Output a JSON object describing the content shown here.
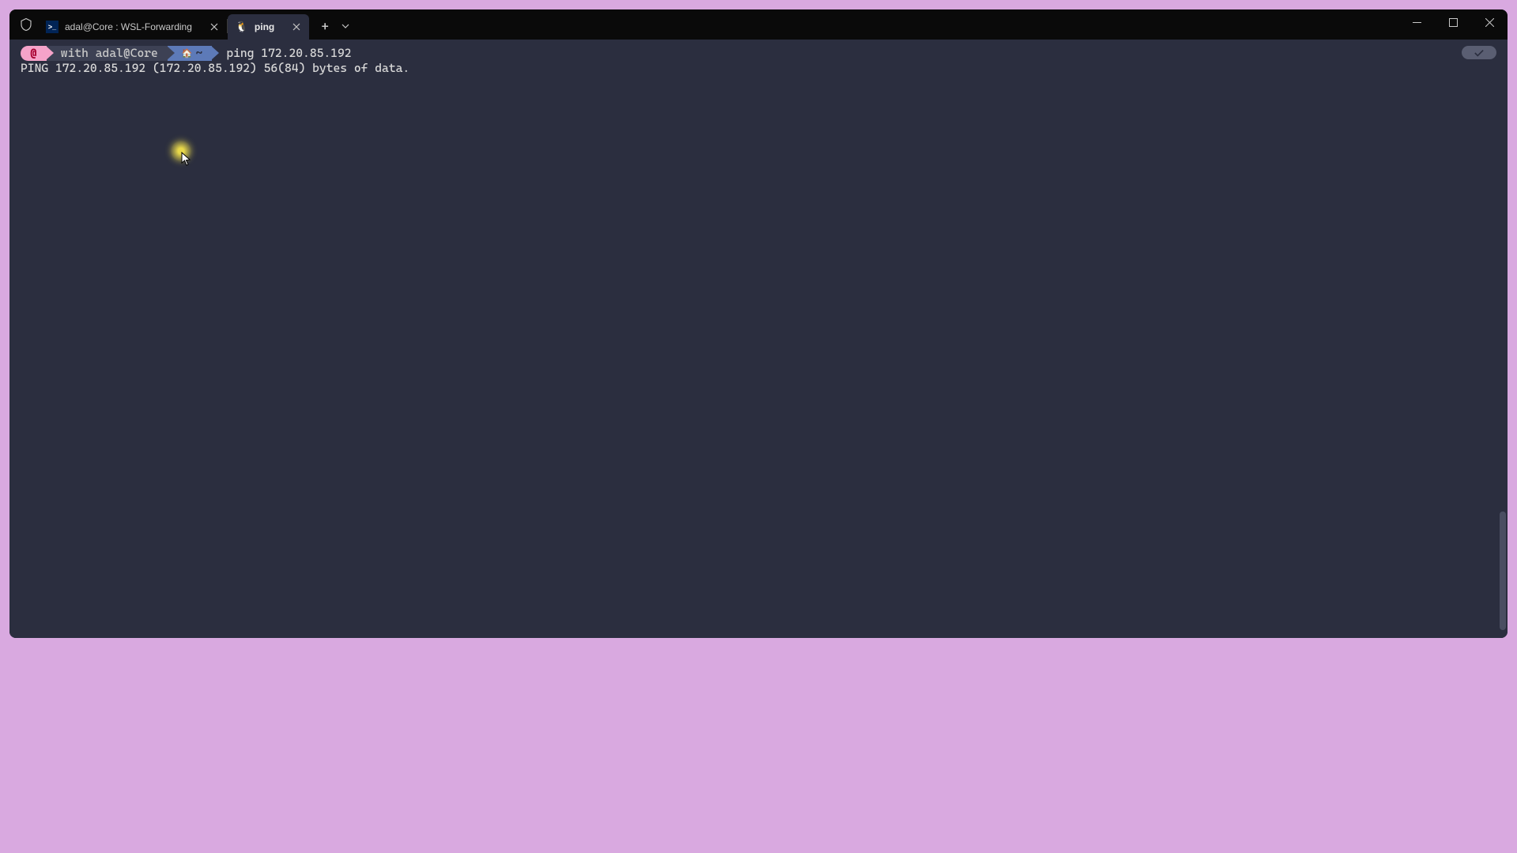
{
  "tabs": [
    {
      "label": "adal@Core : WSL-Forwarding",
      "icon": "powershell"
    },
    {
      "label": "ping",
      "icon": "tux"
    }
  ],
  "prompt": {
    "seg1_icon": "debian",
    "seg2_text": "with adal@Core",
    "seg3_home": "~",
    "command": "ping 172.20.85.192"
  },
  "output": {
    "line1": "PING 172.20.85.192 (172.20.85.192) 56(84) bytes of data."
  }
}
